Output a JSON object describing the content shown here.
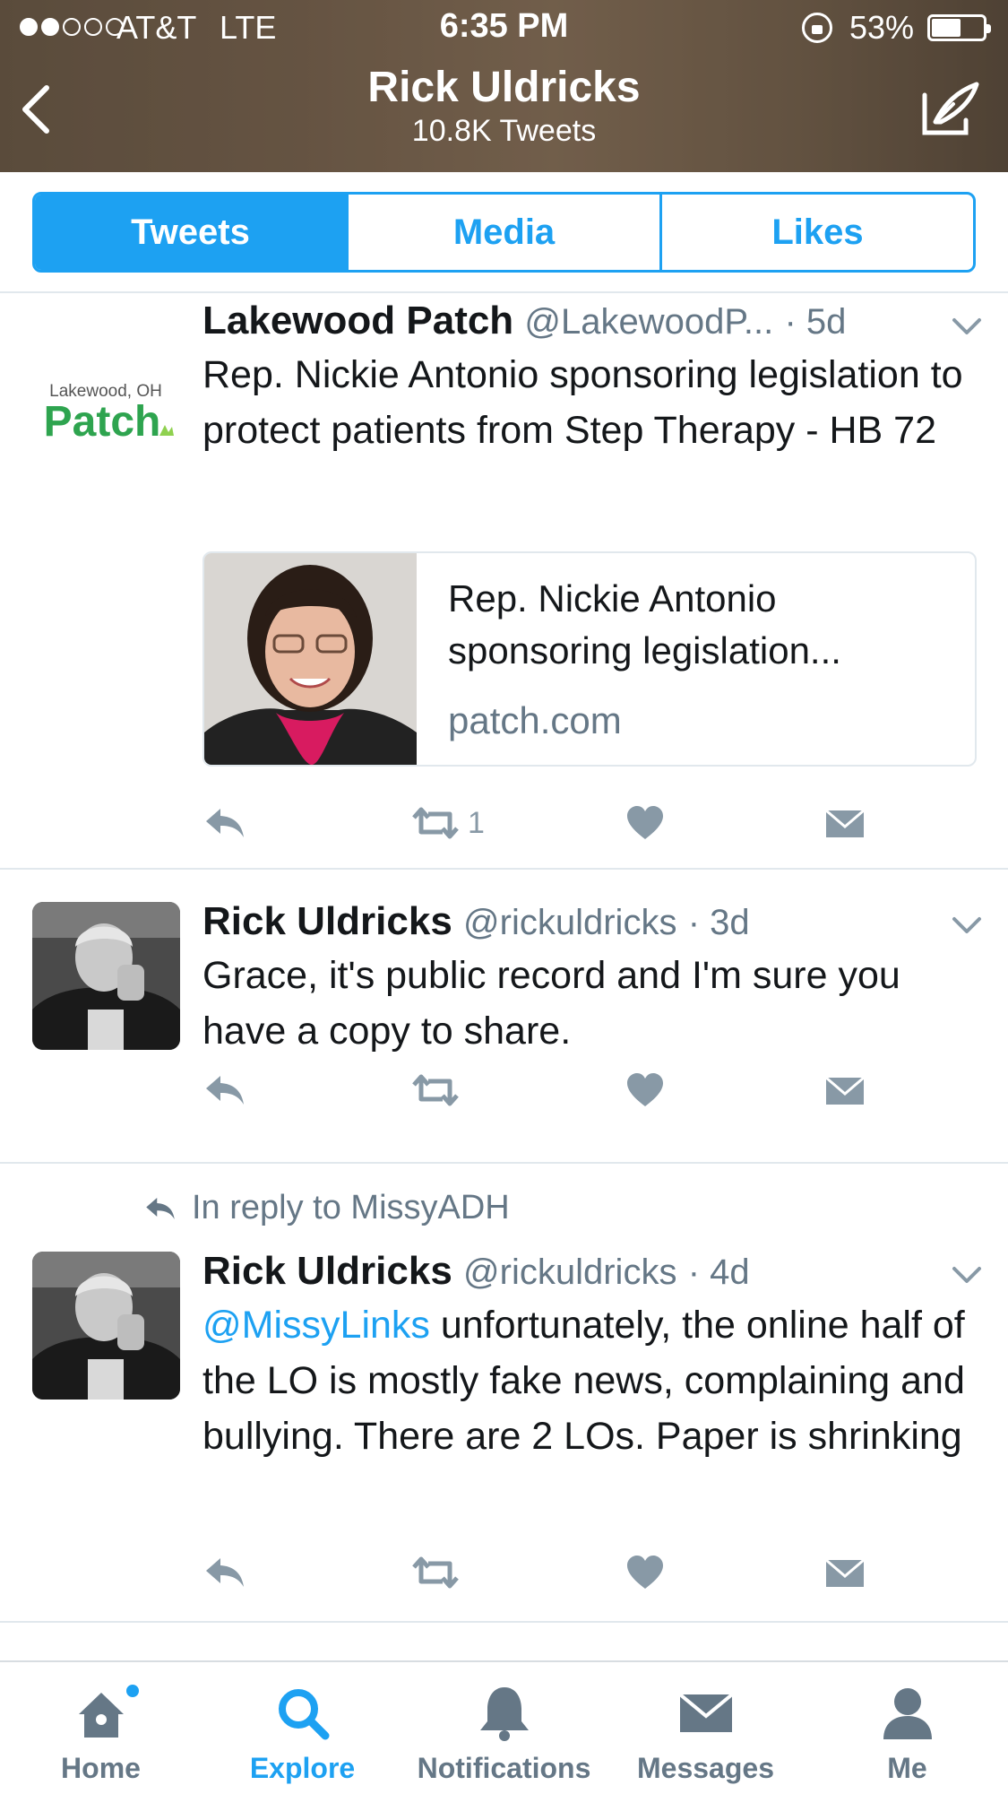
{
  "status_bar": {
    "carrier": "AT&T",
    "network": "LTE",
    "time": "6:35 PM",
    "battery": "53%",
    "battery_level": 0.53,
    "signal_bars_filled": 2,
    "signal_bars_total": 5
  },
  "header": {
    "title": "Rick Uldricks",
    "subtitle": "10.8K Tweets"
  },
  "segments": {
    "items": [
      "Tweets",
      "Media",
      "Likes"
    ],
    "active": "Tweets"
  },
  "tweets": [
    {
      "avatar_lines": [
        "Lakewood, OH",
        "Patch"
      ],
      "name": "Lakewood Patch",
      "handle": "@LakewoodP...",
      "ago": "· 5d",
      "text": "Rep. Nickie Antonio sponsoring legislation to protect patients from Step Therapy - HB 72",
      "card": {
        "title": "Rep. Nickie Antonio sponsoring legislation...",
        "domain": "patch.com"
      },
      "retweet_count": "1"
    },
    {
      "name": "Rick Uldricks",
      "handle": "@rickuldricks",
      "ago": "· 3d",
      "text": "Grace, it's public record and I'm sure you have a copy to share."
    },
    {
      "reply_context": "In reply to MissyADH",
      "name": "Rick Uldricks",
      "handle": "@rickuldricks",
      "ago": "· 4d",
      "mention": "@MissyLinks",
      "text": " unfortunately, the online half of the LO is mostly fake news, complaining and bullying. There are 2 LOs. Paper is shrinking"
    }
  ],
  "tab_bar": {
    "tabs": [
      "Home",
      "Explore",
      "Notifications",
      "Messages",
      "Me"
    ],
    "active": "Explore"
  },
  "colors": {
    "accent": "#1da1f2",
    "secondary_text": "#657786",
    "icon_gray": "#8899a6",
    "patch_green": "#2ea44f"
  }
}
